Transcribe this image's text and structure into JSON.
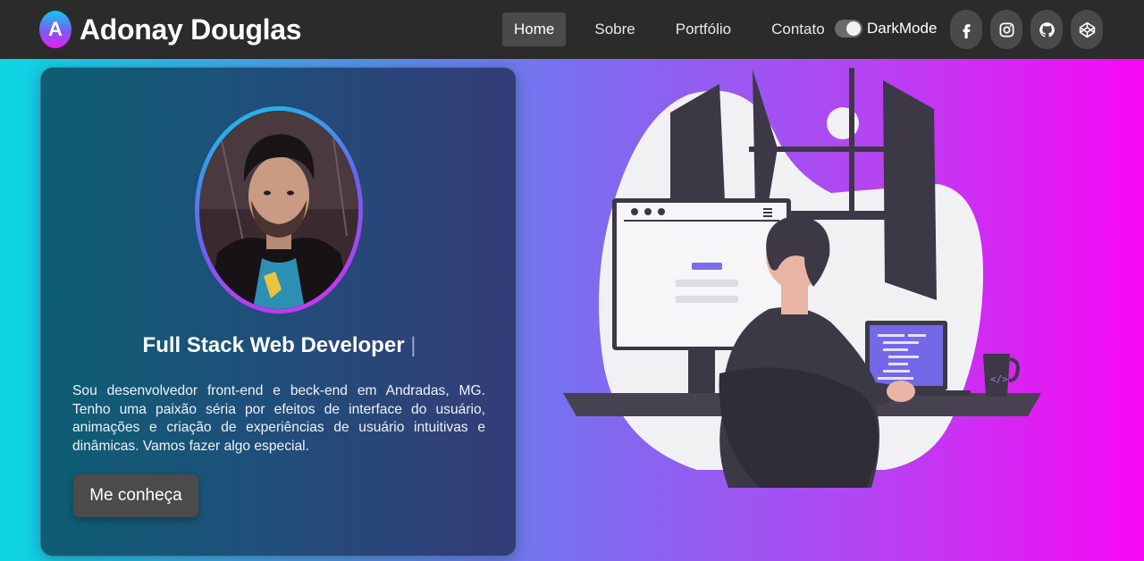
{
  "brand": {
    "logo_letter": "A",
    "name": "Adonay Douglas"
  },
  "nav": {
    "items": [
      {
        "label": "Home",
        "active": true
      },
      {
        "label": "Sobre",
        "active": false
      },
      {
        "label": "Portfólio",
        "active": false
      },
      {
        "label": "Contato",
        "active": false
      }
    ],
    "dark_mode_label": "DarkMode",
    "dark_mode_on": true
  },
  "socials": [
    {
      "icon": "facebook-icon"
    },
    {
      "icon": "instagram-icon"
    },
    {
      "icon": "github-icon"
    },
    {
      "icon": "codepen-icon"
    }
  ],
  "hero": {
    "title": "Full Stack Web Developer",
    "cursor": "|",
    "description": "Sou desenvolvedor front-end e beck-end em Andradas, MG. Tenho uma paixão séria por efeitos de interface do usuário, animações e criação de experiências de usuário intuitivas e dinâmicas. Vamos fazer algo especial.",
    "cta_label": "Me conheça"
  },
  "colors": {
    "navbar": "#2b2b2b",
    "gradient_start": "#0bd6e3",
    "gradient_end": "#f807f4",
    "card": "#1f4f7a",
    "button": "#4b4b4b"
  }
}
